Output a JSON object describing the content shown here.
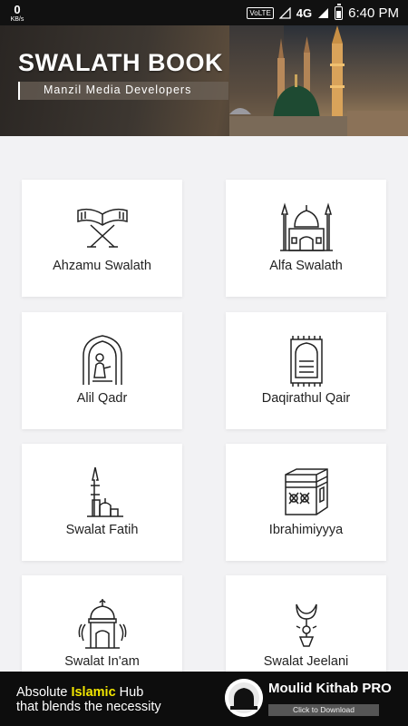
{
  "status_bar": {
    "data_speed": "0",
    "data_unit": "KB/s",
    "volte": "VoLTE",
    "network": "4G",
    "time": "6:40 PM"
  },
  "header": {
    "title": "SWALATH BOOK",
    "subtitle": "Manzil Media Developers"
  },
  "items": [
    {
      "label": "Ahzamu Swalath",
      "icon": "quran-stand-icon"
    },
    {
      "label": "Alfa Swalath",
      "icon": "mosque-icon"
    },
    {
      "label": "Alil Qadr",
      "icon": "praying-person-icon"
    },
    {
      "label": "Daqirathul Qair",
      "icon": "prayer-rug-icon"
    },
    {
      "label": "Swalat Fatih",
      "icon": "minaret-icon"
    },
    {
      "label": "Ibrahimiyyya",
      "icon": "kaaba-icon"
    },
    {
      "label": "Swalat In'am",
      "icon": "dome-icon"
    },
    {
      "label": "Swalat Jeelani",
      "icon": "crescent-lamp-icon"
    }
  ],
  "ad": {
    "line1_prefix": "Absolute ",
    "line1_highlight": "Islamic",
    "line1_suffix": " Hub",
    "line2": "that blends the necessity",
    "app_name": "Moulid Kithab PRO",
    "cta": "Click to Download"
  }
}
